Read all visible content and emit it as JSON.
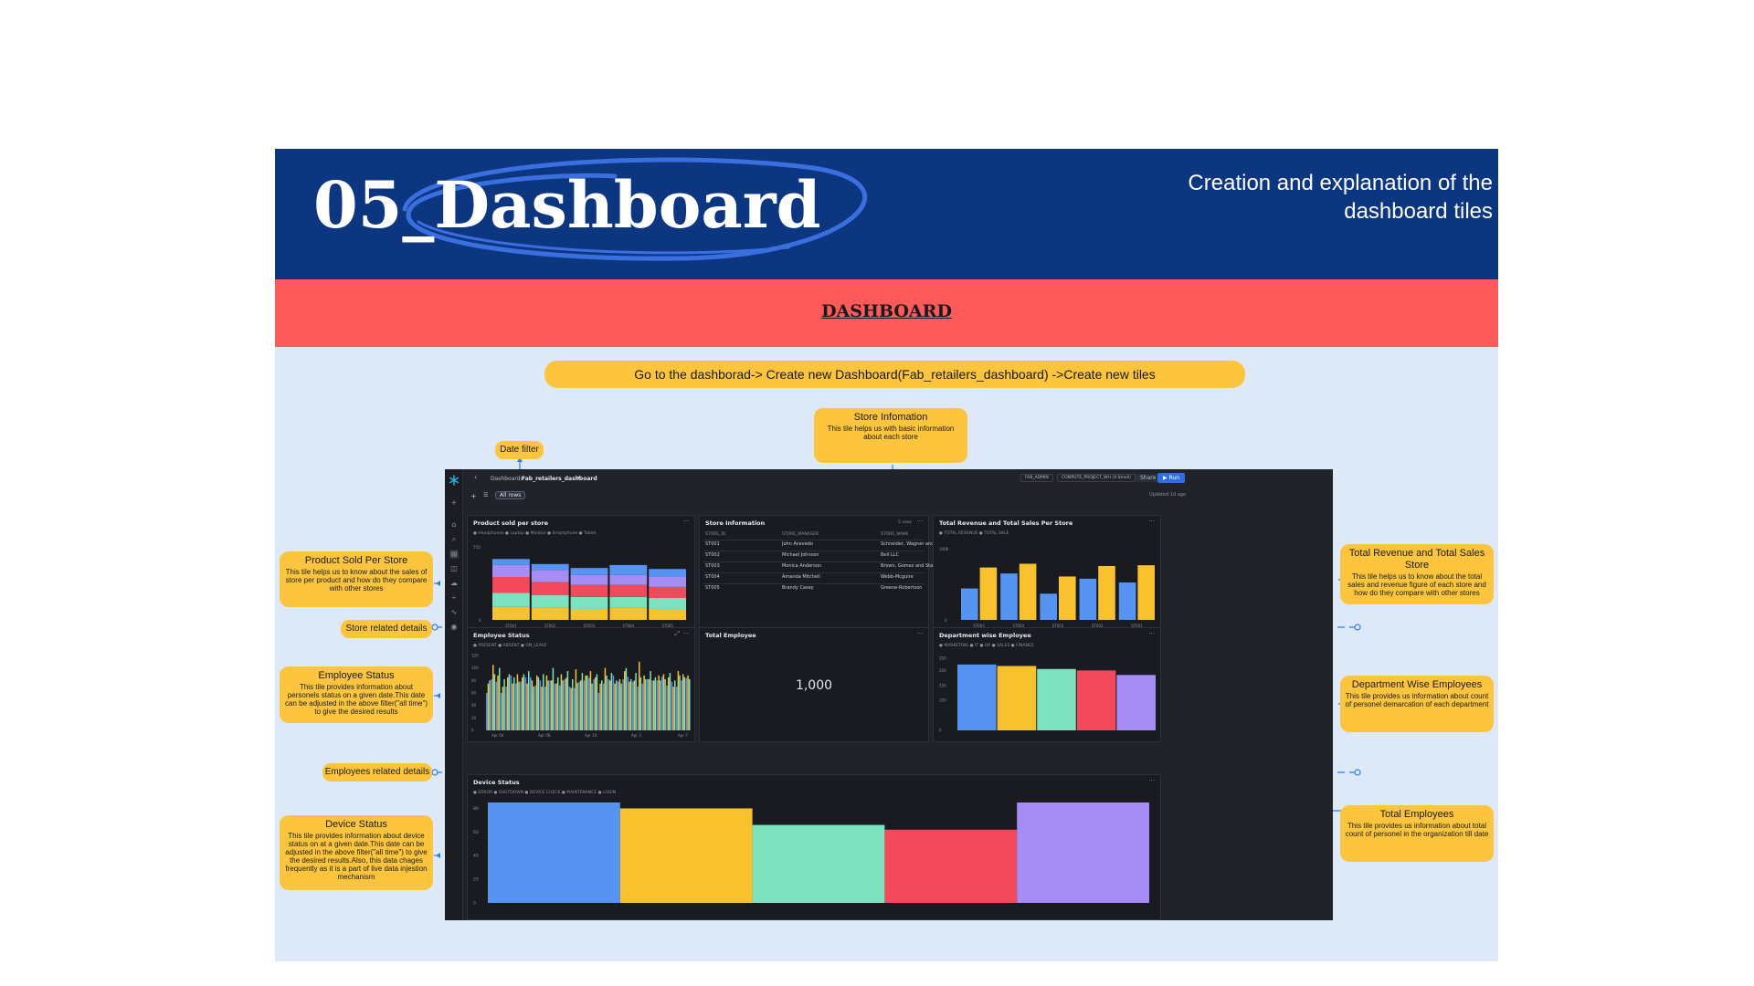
{
  "header": {
    "title": "05_Dashboard",
    "subtitle": "Creation and explanation of the dashboard tiles"
  },
  "banner": {
    "title": "DASHBOARD"
  },
  "instruction": "Go to the dashborad-> Create new Dashboard(Fab_retailers_dashboard) ->Create new tiles",
  "tags": {
    "date_filter": "Date filter",
    "store_related": "Store related details",
    "employees_related": "Employees related details"
  },
  "callouts": {
    "store_info": {
      "title": "Store Infomation",
      "desc": "This tile helps us with basic information about each store"
    },
    "product_sold": {
      "title": "Product Sold Per Store",
      "desc": "This tile helps us to know about the sales of store per product and how do they compare with other stores"
    },
    "employee_status": {
      "title": "Employee Status",
      "desc": "This tile provides information about personels status on a given date.This date can be adjusted in the above filter(\"all time\") to give the desired results"
    },
    "device_status": {
      "title": "Device Status",
      "desc": "This tile provides information about device status on at a given date.This date can be adjusted in the above filter(\"all time\") to give the desired results.Also, this data chages frequently as it is a part of live data injestion mechanism"
    },
    "total_revenue": {
      "title": "Total Revenue and Total Sales Store",
      "desc": "This tile helps us to know about the total sales and revenue figure of each store and how do they compare with other stores"
    },
    "dept_employees": {
      "title": "Department Wise Employees",
      "desc": "This tile provides us information about count of personel demarcation of each department"
    },
    "total_employees": {
      "title": "Total Employees",
      "desc": "This tile provides us information about total count of personel in the organization till date"
    }
  },
  "dashboard": {
    "breadcrumb_root": "Dashboards",
    "dashboard_name": "Fab_retailers_dashboard",
    "filter_label": "All rows",
    "role": "FAB_ADMIN",
    "warehouse": "COMPUTE_PROJECT_WH (X-Small)",
    "share_label": "Share",
    "run_label": "▶ Run",
    "updated": "Updated 1d ago",
    "colors": {
      "blue": "#5794f2",
      "yellow": "#f8c22e",
      "green": "#7ee2c0",
      "red": "#f2495c",
      "purple": "#a58df5"
    },
    "tiles": {
      "product_sold": {
        "title": "Product sold per store",
        "legend": "● Headphones  ● Laptop  ● Monitor  ● Smartphone  ● Tablet",
        "y_top": "750",
        "y_zero": "0",
        "chart_data": {
          "type": "bar",
          "stacked": true,
          "categories": [
            "ST001",
            "ST002",
            "ST003",
            "ST004",
            "ST005"
          ],
          "series": [
            {
              "name": "Headphones",
              "values": [
                130,
                120,
                110,
                120,
                110
              ]
            },
            {
              "name": "Laptop",
              "values": [
                140,
                130,
                120,
                110,
                110
              ]
            },
            {
              "name": "Monitor",
              "values": [
                160,
                130,
                120,
                120,
                110
              ]
            },
            {
              "name": "Smartphone",
              "values": [
                120,
                120,
                100,
                100,
                100
              ]
            },
            {
              "name": "Tablet",
              "values": [
                60,
                60,
                70,
                100,
                80
              ]
            }
          ]
        }
      },
      "store_info": {
        "title": "Store Information",
        "rows_label": "5 rows",
        "columns": [
          "STORE_ID",
          "STORE_MANAGER",
          "STORE_NAME"
        ],
        "rows": [
          [
            "ST001",
            "John Acevedo",
            "Schneider, Wagner and Reid"
          ],
          [
            "ST002",
            "Michael Johnson",
            "Bell LLC"
          ],
          [
            "ST003",
            "Monica Anderson",
            "Brown, Gomez and Stafford"
          ],
          [
            "ST004",
            "Amanda Mitchell",
            "Webb-Mcguire"
          ],
          [
            "ST005",
            "Brandy Casey",
            "Greene-Robertson"
          ]
        ]
      },
      "revenue": {
        "title": "Total Revenue and Total Sales Per Store",
        "legend": "● TOTAL REVENUE  ● TOTAL SALE",
        "y_top": "100K",
        "y_zero": "0",
        "chart_data": {
          "type": "bar",
          "categories": [
            "ST005",
            "ST004",
            "ST003",
            "ST002",
            "ST001"
          ],
          "series": [
            {
              "name": "TOTAL REVENUE",
              "values": [
                42,
                62,
                35,
                55,
                50
              ]
            },
            {
              "name": "TOTAL SALE",
              "values": [
                70,
                75,
                58,
                72,
                73
              ]
            }
          ]
        }
      },
      "employee_status": {
        "title": "Employee Status",
        "legend": "● PRESENT  ● ABSENT  ● ON_LEAVE",
        "y_ticks": [
          "0",
          "20",
          "40",
          "60",
          "80",
          "100",
          "120"
        ],
        "x_labels": [
          "Apr 04",
          "Apr 08",
          "Apr 14",
          "Apr 3",
          "Apr 7"
        ],
        "chart_data": {
          "type": "bar",
          "series": [
            {
              "name": "PRESENT",
              "values": [
                60,
                82,
                78,
                60,
                70,
                88,
                75,
                78,
                85,
                85,
                72,
                80,
                70,
                80,
                75,
                72,
                82,
                70,
                68,
                78,
                80,
                84,
                82,
                60,
                75,
                82,
                88,
                78,
                82,
                86,
                78,
                70,
                75,
                82,
                80,
                80,
                86,
                72,
                78,
                70,
                80,
                84
              ]
            },
            {
              "name": "ABSENT",
              "values": [
                75,
                105,
                88,
                70,
                85,
                75,
                90,
                85,
                75,
                80,
                88,
                70,
                88,
                80,
                75,
                90,
                84,
                68,
                98,
                80,
                88,
                95,
                85,
                75,
                100,
                80,
                75,
                82,
                95,
                78,
                80,
                110,
                88,
                82,
                80,
                88,
                90,
                85,
                70,
                95,
                90,
                88
              ]
            },
            {
              "name": "ON_LEAVE",
              "values": [
                80,
                90,
                100,
                82,
                90,
                85,
                78,
                90,
                95,
                70,
                85,
                90,
                80,
                100,
                85,
                80,
                95,
                82,
                76,
                92,
                88,
                75,
                90,
                80,
                88,
                92,
                80,
                75,
                100,
                82,
                92,
                85,
                82,
                95,
                85,
                80,
                82,
                92,
                80,
                88,
                85,
                82
              ]
            }
          ]
        }
      },
      "total_employee": {
        "title": "Total Employee",
        "value": "1,000"
      },
      "department": {
        "title": "Department wise Employee",
        "legend": "● MARKETING  ● IT  ● HR  ● SALES  ● FINANCE",
        "y_ticks": [
          "0",
          "100",
          "150",
          "200",
          "250"
        ],
        "chart_data": {
          "type": "bar",
          "categories": [
            "MARKETING",
            "IT",
            "HR",
            "SALES",
            "FINANCE"
          ],
          "values": [
            220,
            215,
            205,
            200,
            185
          ]
        }
      },
      "device_status": {
        "title": "Device Status",
        "legend": "● ERROR  ● SHUTDOWN  ● DEVICE CHECK  ● MAINTENANCE  ● LOGIN",
        "y_ticks": [
          "0",
          "20",
          "40",
          "60",
          "80"
        ],
        "chart_data": {
          "type": "bar",
          "categories": [
            "ERROR",
            "SHUTDOWN",
            "DEVICE CHECK",
            "MAINTENANCE",
            "LOGIN"
          ],
          "values": [
            85,
            80,
            66,
            62,
            85
          ]
        }
      }
    }
  }
}
